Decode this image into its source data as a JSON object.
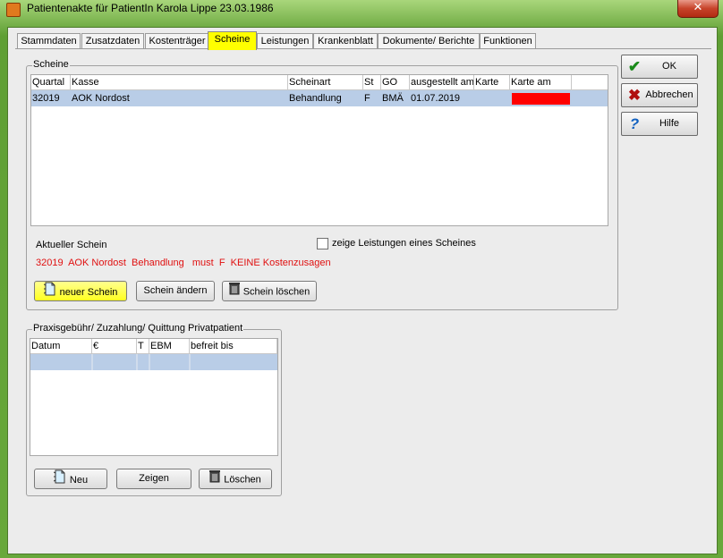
{
  "window": {
    "title": "Patientenakte für PatientIn Karola Lippe 23.03.1986",
    "close": "✕"
  },
  "tabs": [
    {
      "label": "Stammdaten"
    },
    {
      "label": "Zusatzdaten"
    },
    {
      "label": "Kostenträger"
    },
    {
      "label": "Scheine"
    },
    {
      "label": "Leistungen"
    },
    {
      "label": "Krankenblatt"
    },
    {
      "label": "Dokumente/ Berichte"
    },
    {
      "label": "Funktionen"
    }
  ],
  "active_tab": "Scheine",
  "scheine": {
    "group_label": "Scheine",
    "columns": [
      "Quartal",
      "Kasse",
      "Scheinart",
      "St",
      "GO",
      "ausgestellt am",
      "Karte",
      "Karte am"
    ],
    "rows": [
      {
        "quartal": "32019",
        "kasse": "AOK Nordost",
        "scheinart": "Behandlung",
        "st": "F",
        "go": "BMÄ",
        "ausgestellt": "01.07.2019",
        "karte": "",
        "karte_am_color": "#ff0000"
      }
    ],
    "aktueller_label": "Aktueller Schein",
    "aktueller_text": "32019  AOK Nordost  Behandlung   must  F  KEINE Kostenzusagen",
    "checkbox_label": "zeige Leistungen eines Scheines",
    "checkbox_checked": false,
    "buttons": {
      "neu": "neuer Schein",
      "aendern": "Schein ändern",
      "loeschen": "Schein löschen"
    }
  },
  "praxis": {
    "group_label": "Praxisgebühr/ Zuzahlung/ Quittung Privatpatient",
    "columns": [
      "Datum",
      "€",
      "T",
      "EBM",
      "befreit bis"
    ],
    "buttons": {
      "neu": "Neu",
      "zeigen": "Zeigen",
      "loeschen": "Löschen"
    }
  },
  "side": {
    "ok": "OK",
    "abbrechen": "Abbrechen",
    "hilfe": "Hilfe"
  },
  "colors": {
    "active_tab": "#ffff00",
    "selected_row": "#b9cde7",
    "warning_text": "#e01010",
    "frame": "#6cae3e"
  }
}
